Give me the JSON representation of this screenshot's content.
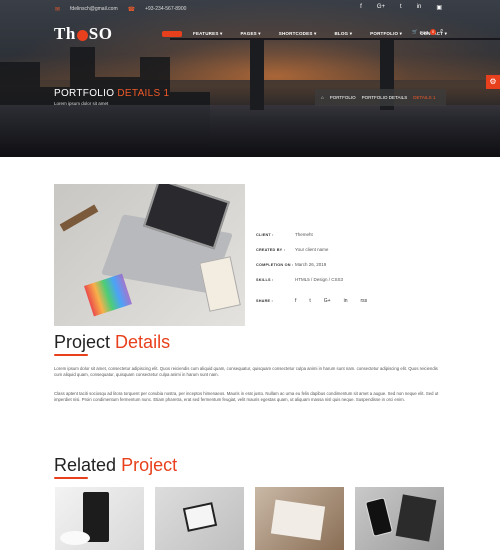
{
  "topbar": {
    "email": "fdelinsch@gmail.com",
    "phone": "+93-234-567-8900",
    "social_icons": [
      "facebook-icon",
      "google-plus-icon",
      "twitter-icon",
      "linkedin-icon",
      "instagram-icon"
    ],
    "social_glyphs": [
      "f",
      "G+",
      "t",
      "in",
      "▣"
    ]
  },
  "logo": {
    "left": "Th",
    "right": "SO"
  },
  "nav": {
    "items": [
      "FEATURES ▾",
      "PAGES ▾",
      "SHORTCODES ▾",
      "BLOG ▾",
      "PORTFOLIO ▾",
      "CONTACT ▾"
    ],
    "cart_label": "Cart",
    "cart_count": "0"
  },
  "hero": {
    "title_main": "PORTFOLIO",
    "title_accent": "DETAILS 1",
    "subtitle": "Lorem ipsum dolor sit amet",
    "breadcrumb": {
      "home": "⌂",
      "items": [
        "PORTFOLIO",
        "PORTFOLIO DETAILS"
      ],
      "current": "DETAILS 1"
    }
  },
  "project_details": {
    "rows": [
      {
        "label": "CLIENT :",
        "value": "Themeht"
      },
      {
        "label": "CREATED BY :",
        "value": "Your client name"
      },
      {
        "label": "COMPLETION ON :",
        "value": "March 26, 2019"
      },
      {
        "label": "SKILLS :",
        "value": "HTML5 / Design / CSS3"
      }
    ],
    "share_label": "SHARE :",
    "share_icons": [
      "f",
      "t",
      "G+",
      "in",
      "rss"
    ]
  },
  "project_heading": {
    "main": "Project",
    "accent": "Details"
  },
  "paragraphs": [
    "Lorem ipsum dolor sit amet, consectetur adipiscing elit. Quos reiciendis cum aliquid quam, consequatur, quisquam consectetur culpa animi in harum sunt nam. consectetur adipiscing elit. Quos reiciendis cum aliquid quam, consequatur, quisquam consectetur culpa animi in harum sunt nam.",
    "Class aptent taciti sociosqu ad litora torquent per conubia nostra, per inceptos himenaeos. Mauris in erat justo. Nullam ac urna eu felis dapibus condimentum sit amet a augue. Sed non neque elit. Sed ut imperdiet nisi. Proin condimentum fermentum nunc. Etiam pharetra, erat sed fermentum feugiat, velit mauris egestas quam, ut aliquam massa nisl quis neque. Suspendisse in orci enim."
  ],
  "related_heading": {
    "main": "Related",
    "accent": "Project"
  }
}
